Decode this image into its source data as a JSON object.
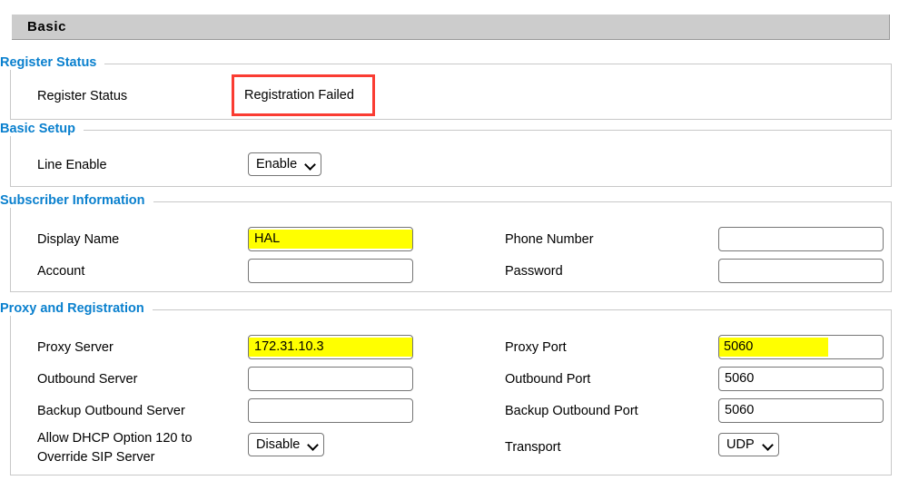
{
  "window": {
    "title": "Basic"
  },
  "sections": {
    "register_status": {
      "legend": "Register Status",
      "rows": [
        {
          "label": "Register Status",
          "value": "Registration Failed"
        }
      ]
    },
    "basic_setup": {
      "legend": "Basic Setup",
      "rows": [
        {
          "label": "Line Enable",
          "value": "Enable"
        }
      ]
    },
    "subscriber_information": {
      "legend": "Subscriber Information",
      "left": [
        {
          "label": "Display Name",
          "value": "HAL",
          "highlighted": true
        },
        {
          "label": "Account",
          "value": "",
          "highlighted": false
        }
      ],
      "right": [
        {
          "label": "Phone Number",
          "value": "",
          "highlighted": false
        },
        {
          "label": "Password",
          "value": "",
          "highlighted": false
        }
      ]
    },
    "proxy_and_registration": {
      "legend": "Proxy and Registration",
      "left": [
        {
          "label": "Proxy Server",
          "value": "172.31.10.3",
          "highlighted": true
        },
        {
          "label": "Outbound Server",
          "value": "",
          "highlighted": false
        },
        {
          "label": "Backup Outbound Server",
          "value": "",
          "highlighted": false
        }
      ],
      "left_dropdown": {
        "label_line1": "Allow DHCP Option 120 to",
        "label_line2": "Override SIP Server",
        "value": "Disable"
      },
      "right": [
        {
          "label": "Proxy Port",
          "value": "5060",
          "highlighted": true
        },
        {
          "label": "Outbound Port",
          "value": "5060",
          "highlighted": false
        },
        {
          "label": "Backup Outbound Port",
          "value": "5060",
          "highlighted": false
        }
      ],
      "right_dropdown": {
        "label": "Transport",
        "value": "UDP"
      }
    }
  },
  "colors": {
    "legend_blue": "#0a80ce",
    "highlight_yellow": "#ffff00",
    "callout_red": "#fa3c32",
    "titlebar_gray": "#cccccc"
  }
}
